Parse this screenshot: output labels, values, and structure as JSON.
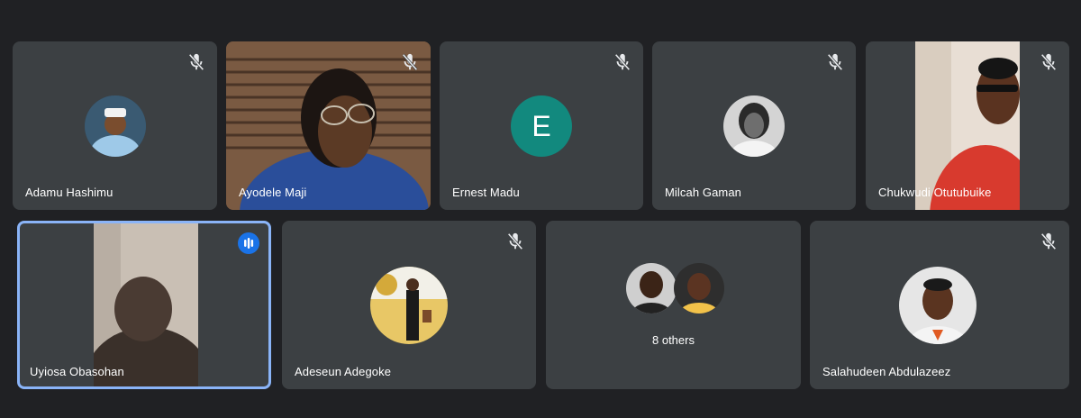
{
  "meeting": {
    "participants": [
      {
        "name": "Adamu Hashimu",
        "muted": true,
        "avatar": "photo-man-white-cap"
      },
      {
        "name": "Ayodele Maji",
        "muted": true,
        "video": true
      },
      {
        "name": "Ernest Madu",
        "muted": true,
        "initial": "E",
        "initial_color": "#12897e"
      },
      {
        "name": "Milcah Gaman",
        "muted": true,
        "avatar": "photo-woman-grayscale"
      },
      {
        "name": "Chukwudi Otutubuike",
        "muted": true,
        "video": true
      },
      {
        "name": "Uyiosa Obasohan",
        "speaking": true,
        "video": true
      },
      {
        "name": "Adeseun Adegoke",
        "muted": true,
        "avatar": "photo-man-suit-yellow-banner"
      },
      {
        "name": "Salahudeen Abdulazeez",
        "muted": true,
        "avatar": "photo-young-man"
      }
    ],
    "others": {
      "label": "8 others"
    }
  },
  "icons": {
    "muted": "mic-off-icon",
    "speaking": "audio-level-icon"
  },
  "colors": {
    "background": "#202124",
    "tile": "#3c4043",
    "active_border": "#8ab4f8",
    "speaking_badge": "#1a73e8"
  }
}
